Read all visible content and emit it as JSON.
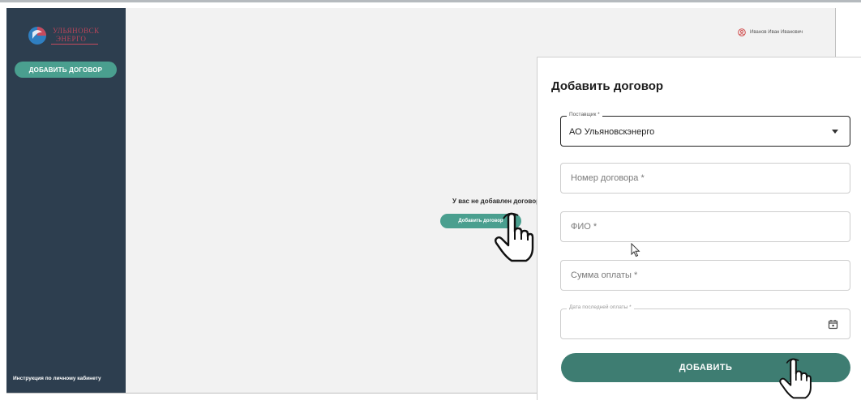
{
  "sidebar": {
    "logo_text_line1": "УЛЬЯНОВСК",
    "logo_text_line2": "ЭНЕРГО",
    "add_contract_label": "ДОБАВИТЬ ДОГОВОР",
    "instructions_link": "Инструкция по личному кабинету"
  },
  "header": {
    "user_name": "Иванов Иван Иванович"
  },
  "main": {
    "empty_message": "У вас не добавлен договор",
    "add_contract_button": "Добавить договор"
  },
  "modal": {
    "title": "Добавить договор",
    "supplier": {
      "label": "Поставщик *",
      "value": "АО Ульяновскэнерго"
    },
    "contract_number_placeholder": "Номер договора *",
    "full_name_placeholder": "ФИО *",
    "payment_amount_placeholder": "Сумма оплаты *",
    "last_payment_date_label": "Дата последней оплаты *",
    "submit_label": "ДОБАВИТЬ"
  },
  "colors": {
    "sidebar_bg": "#2d3e4f",
    "accent": "#4a9f8f",
    "submit_bg": "#3e7d72",
    "logo_red": "#c64b5e",
    "logo_blue": "#2f7fc1"
  },
  "icons": [
    "logo-icon",
    "user-icon",
    "chevron-down-icon",
    "calendar-icon",
    "hand-pointer-icon",
    "mouse-cursor-icon"
  ]
}
